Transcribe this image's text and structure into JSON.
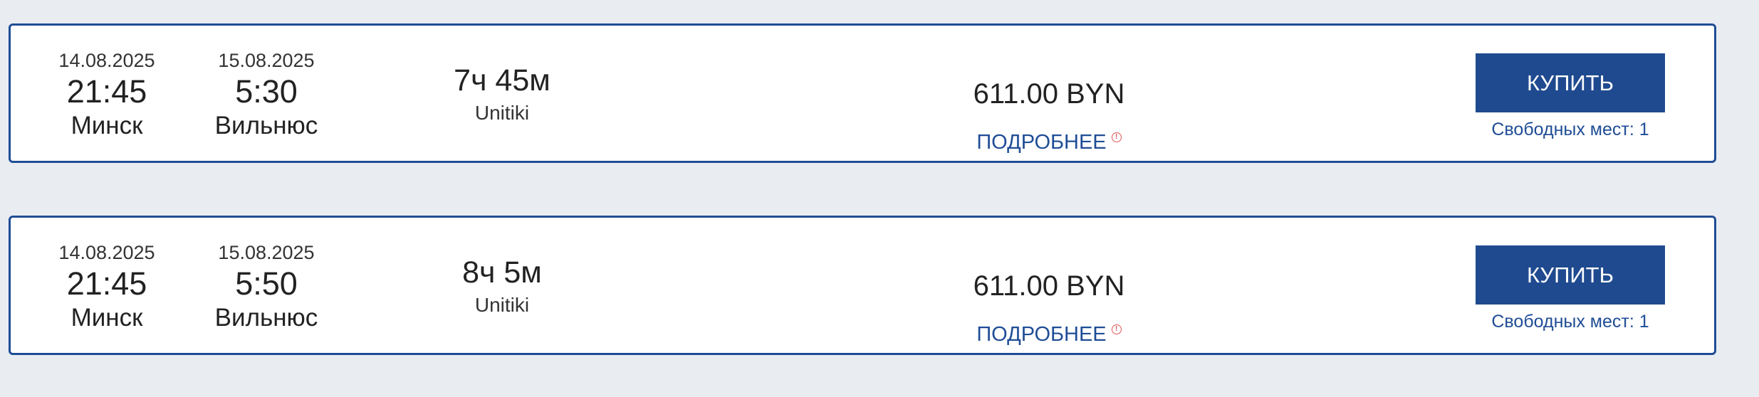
{
  "trips": [
    {
      "departure": {
        "date": "14.08.2025",
        "time": "21:45",
        "city": "Минск"
      },
      "arrival": {
        "date": "15.08.2025",
        "time": "5:30",
        "city": "Вильнюс"
      },
      "duration": "7ч 45м",
      "carrier": "Unitiki",
      "price": "611.00 BYN",
      "details_label": "ПОДРОБНЕЕ",
      "info_icon_glyph": "!",
      "buy_label": "КУПИТЬ",
      "seats": "Свободных мест: 1"
    },
    {
      "departure": {
        "date": "14.08.2025",
        "time": "21:45",
        "city": "Минск"
      },
      "arrival": {
        "date": "15.08.2025",
        "time": "5:50",
        "city": "Вильнюс"
      },
      "duration": "8ч 5м",
      "carrier": "Unitiki",
      "price": "611.00 BYN",
      "details_label": "ПОДРОБНЕЕ",
      "info_icon_glyph": "!",
      "buy_label": "КУПИТЬ",
      "seats": "Свободных мест: 1"
    }
  ],
  "colors": {
    "accent": "#1f4a8f",
    "border": "#1f4d96",
    "info_icon": "#e0575a",
    "background": "#e9edf2"
  },
  "icons": {
    "details_info": "info-circle-icon"
  }
}
